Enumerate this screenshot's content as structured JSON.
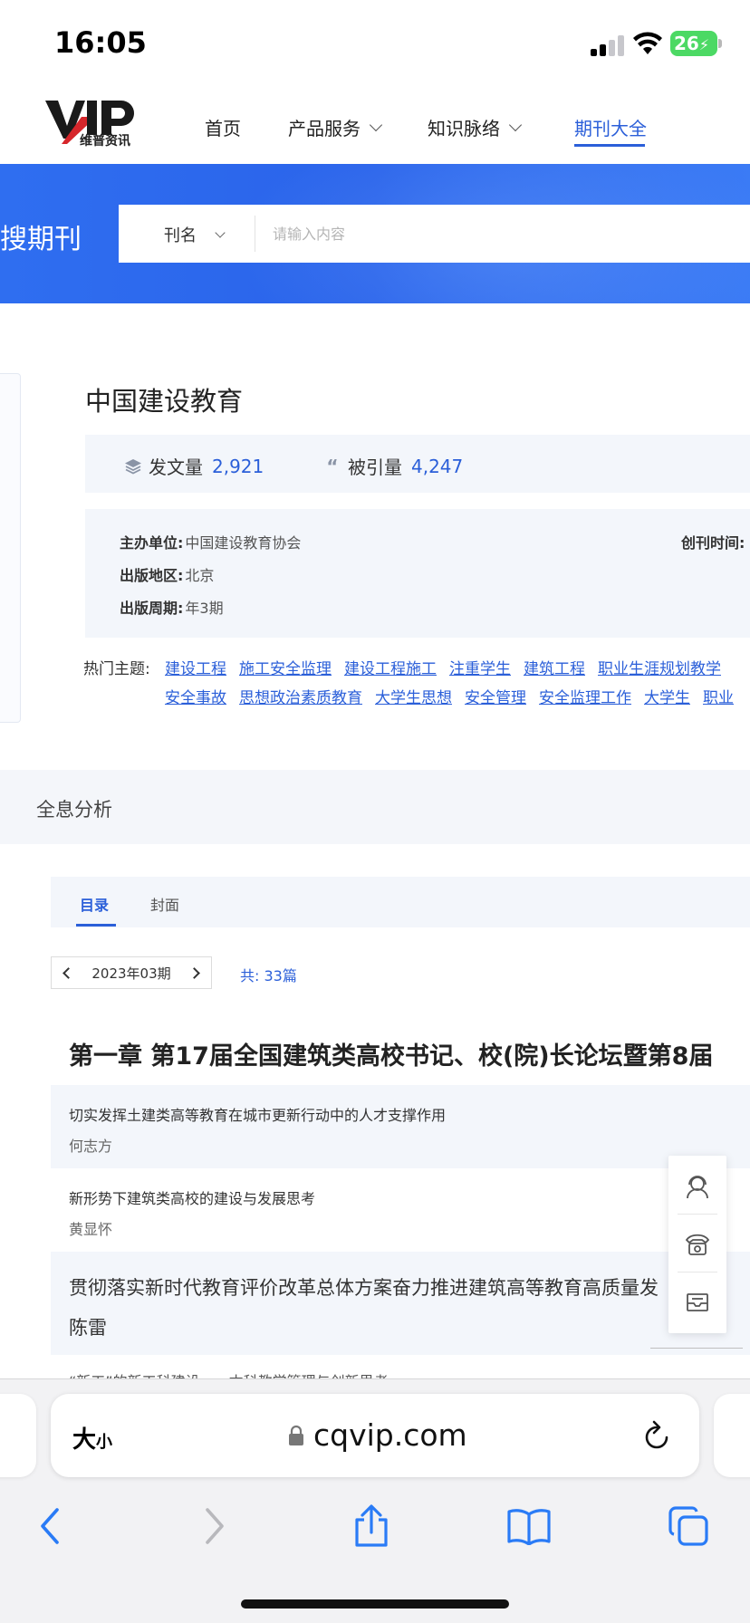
{
  "status_bar": {
    "time": "16:05",
    "battery": "26"
  },
  "site_nav": {
    "logo_text": "VIP",
    "logo_sub": "维普资讯",
    "items": [
      {
        "label": "首页",
        "has_dropdown": false,
        "active": false
      },
      {
        "label": "产品服务",
        "has_dropdown": true,
        "active": false
      },
      {
        "label": "知识脉络",
        "has_dropdown": true,
        "active": false
      },
      {
        "label": "期刊大全",
        "has_dropdown": false,
        "active": true
      }
    ]
  },
  "search": {
    "title": "搜期刊",
    "type_label": "刊名",
    "placeholder": "请输入内容"
  },
  "journal": {
    "title": "中国建设教育",
    "stats": {
      "articles_label": "发文量",
      "articles_value": "2,921",
      "citations_label": "被引量",
      "citations_value": "4,247"
    },
    "meta": {
      "sponsor_label": "主办单位:",
      "sponsor_value": "中国建设教育协会",
      "location_label": "出版地区:",
      "location_value": "北京",
      "cycle_label": "出版周期:",
      "cycle_value": "年3期",
      "founded_label": "创刊时间:"
    },
    "topics_label": "热门主题:",
    "topics_line1": [
      "建设工程",
      "施工安全监理",
      "建设工程施工",
      "注重学生",
      "建筑工程",
      "职业生涯规划教学"
    ],
    "topics_line2": [
      "安全事故",
      "思想政治素质教育",
      "大学生思想",
      "安全管理",
      "安全监理工作",
      "大学生",
      "职业"
    ]
  },
  "analysis": {
    "label": "全息分析",
    "tabs": [
      {
        "label": "目录",
        "active": true
      },
      {
        "label": "封面",
        "active": false
      }
    ],
    "issue": "2023年03期",
    "count": "共: 33篇",
    "chapter_title": "第一章 第17届全国建筑类高校书记、校(院)长论坛暨第8届",
    "articles": [
      {
        "title": "切实发挥土建类高等教育在城市更新行动中的人才支撑作用",
        "author": "何志方"
      },
      {
        "title": "新形势下建筑类高校的建设与发展思考",
        "author": "黄显怀"
      },
      {
        "title": "贯彻落实新时代教育评价改革总体方案奋力推进建筑高等教育高质量发",
        "author": "陈雷"
      }
    ],
    "next_article_partial": "“新工”的新工科建设——本科教学管理与创新思考"
  },
  "float_panel": {
    "icons": [
      "customer-service-icon",
      "telephone-icon",
      "message-icon"
    ]
  },
  "safari": {
    "text_size_label": "大",
    "text_size_small": "小",
    "url": "cqvip.com"
  },
  "colors": {
    "accent": "#2b5fd9",
    "banner": "#2f6ef0",
    "panel_bg": "#f3f6fb"
  }
}
